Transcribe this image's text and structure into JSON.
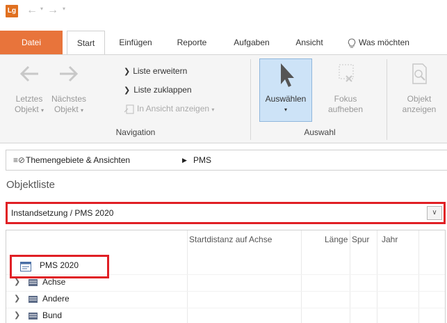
{
  "titlebar": {
    "logo": "Lg",
    "back_icon": "arrow-left-icon",
    "forward_icon": "arrow-right-icon"
  },
  "tabs": [
    {
      "label": "Datei"
    },
    {
      "label": "Start"
    },
    {
      "label": "Einfügen"
    },
    {
      "label": "Reporte"
    },
    {
      "label": "Aufgaben"
    },
    {
      "label": "Ansicht"
    },
    {
      "label": "Was möchten"
    }
  ],
  "ribbon": {
    "navigation": {
      "group_label": "Navigation",
      "prev_label_1": "Letztes",
      "prev_label_2": "Objekt",
      "next_label_1": "Nächstes",
      "next_label_2": "Objekt",
      "expand_list": "Liste erweitern",
      "collapse_list": "Liste zuklappen",
      "show_in_view": "In Ansicht anzeigen"
    },
    "selection": {
      "group_label": "Auswahl",
      "select_label": "Auswählen",
      "clear_focus_1": "Fokus",
      "clear_focus_2": "aufheben"
    },
    "object": {
      "show_object_1": "Objekt",
      "show_object_2": "anzeigen"
    }
  },
  "breadcrumb": {
    "root": "Themengebiete & Ansichten",
    "current": "PMS"
  },
  "objectlist": {
    "title": "Objektliste",
    "dropdown_value": "Instandsetzung / PMS 2020",
    "columns": [
      "Startdistanz auf Achse",
      "Länge",
      "Spur",
      "Jahr"
    ],
    "root_item": "PMS 2020",
    "items": [
      "Achse",
      "Andere",
      "Bund"
    ]
  },
  "colors": {
    "file_tab": "#e8743b",
    "highlight": "#e01f25",
    "select_button": "#cde3f7"
  }
}
